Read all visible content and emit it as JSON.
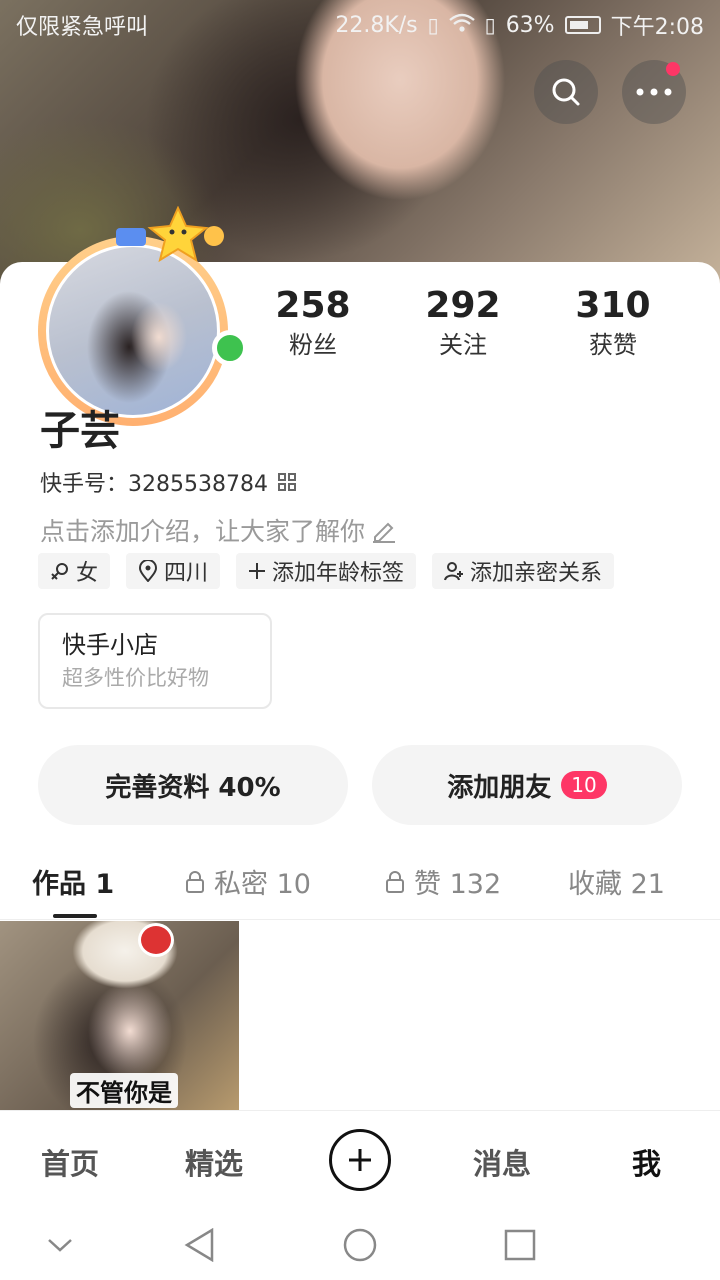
{
  "status_bar": {
    "carrier_text": "仅限紧急呼叫",
    "net_speed": "22.8K/s",
    "battery_percent": "63%",
    "time": "下午2:08"
  },
  "profile": {
    "name": "子芸",
    "kuaishou_id": "快手号：3285538784",
    "intro_placeholder": "点击添加介绍，让大家了解你",
    "stats": [
      {
        "value": "258",
        "label": "粉丝"
      },
      {
        "value": "292",
        "label": "关注"
      },
      {
        "value": "310",
        "label": "获赞"
      }
    ],
    "tags": [
      {
        "icon": "female-icon",
        "label": "女"
      },
      {
        "icon": "location-icon",
        "label": "四川"
      },
      {
        "icon": "plus-icon",
        "label": "添加年龄标签"
      },
      {
        "icon": "add-person-icon",
        "label": "添加亲密关系"
      }
    ]
  },
  "shop": {
    "title": "快手小店",
    "subtitle": "超多性价比好物"
  },
  "actions": {
    "complete_profile": "完善资料 40%",
    "add_friends": "添加朋友",
    "add_friends_badge": "10"
  },
  "tabs": [
    {
      "label": "作品 1",
      "locked": false
    },
    {
      "label": "私密 10",
      "locked": true
    },
    {
      "label": "赞 132",
      "locked": true
    },
    {
      "label": "收藏 21",
      "locked": false
    }
  ],
  "works": [
    {
      "caption": "不管你是"
    }
  ],
  "bottom_nav": {
    "home": "首页",
    "featured": "精选",
    "messages": "消息",
    "me": "我"
  },
  "colors": {
    "accent": "#fe3666",
    "online": "#3ec24f",
    "avatar_ring": "#ffb070"
  }
}
